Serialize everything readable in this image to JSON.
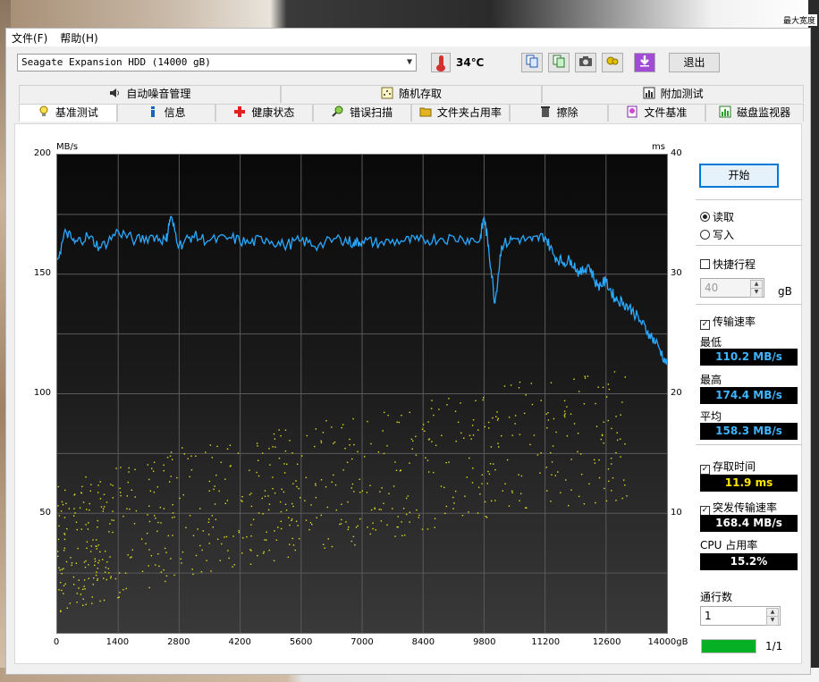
{
  "menu": {
    "file": "文件(F)",
    "help": "帮助(H)"
  },
  "toolbar": {
    "drive": "Seagate Expansion HDD (14000 gB)",
    "temperature": "34℃",
    "exit": "退出",
    "icons": [
      "copy-text-icon",
      "copy-screenshot-icon",
      "camera-icon",
      "settings-icon",
      "save-icon"
    ]
  },
  "tabs_top": [
    "自动噪音管理",
    "随机存取",
    "附加测试"
  ],
  "tabs_bottom": [
    "基准测试",
    "信息",
    "健康状态",
    "错误扫描",
    "文件夹占用率",
    "擦除",
    "文件基准",
    "磁盘监视器"
  ],
  "active_tab": "基准测试",
  "side": {
    "start": "开始",
    "read": "读取",
    "write": "写入",
    "quick": "快捷行程",
    "quick_value": "40",
    "gb": "gB",
    "transfer_rate": "传输速率",
    "min_label": "最低",
    "min_value": "110.2 MB/s",
    "max_label": "最高",
    "max_value": "174.4 MB/s",
    "avg_label": "平均",
    "avg_value": "158.3 MB/s",
    "access_time": "存取时间",
    "access_value": "11.9 ms",
    "burst": "突发传输速率",
    "burst_value": "168.4 MB/s",
    "cpu_label": "CPU 占用率",
    "cpu_value": "15.2%",
    "passes_label": "通行数",
    "passes_value": "1",
    "progress": "1/1",
    "progress_fraction": 1.0
  },
  "chart_data": {
    "type": "line",
    "left_unit": "MB/s",
    "right_unit": "ms",
    "x_unit": "gB",
    "ylim": [
      0,
      200
    ],
    "y2lim": [
      0,
      40
    ],
    "xlim": [
      0,
      14000
    ],
    "yticks": [
      "200",
      "150",
      "100",
      "50"
    ],
    "y2ticks": [
      "40",
      "30",
      "20",
      "10"
    ],
    "xticks": [
      "0",
      "1400",
      "2800",
      "4200",
      "5600",
      "7000",
      "8400",
      "9800",
      "11200",
      "12600",
      "14000gB"
    ],
    "grid": true,
    "series": [
      {
        "kind": "transfer_rate",
        "color": "#29a9ff",
        "x": [
          0,
          200,
          400,
          700,
          1000,
          1400,
          1800,
          2200,
          2500,
          2600,
          2800,
          3100,
          3500,
          4000,
          4400,
          4800,
          5200,
          5600,
          6000,
          6500,
          6800,
          7000,
          7400,
          7900,
          8300,
          8800,
          9300,
          9700,
          9800,
          9900,
          10050,
          10200,
          10500,
          10900,
          11200,
          11400,
          11600,
          11800,
          12000,
          12200,
          12400,
          12600,
          12800,
          13000,
          13200,
          13400,
          13600,
          13800,
          14000
        ],
        "y": [
          156,
          168,
          163,
          166,
          161,
          168,
          164,
          166,
          164,
          174,
          162,
          166,
          164,
          165,
          163,
          165,
          162,
          164,
          162,
          165,
          163,
          164,
          163,
          164,
          164,
          165,
          165,
          164,
          174,
          162,
          138,
          162,
          165,
          164,
          166,
          158,
          155,
          156,
          150,
          154,
          145,
          147,
          140,
          138,
          135,
          130,
          125,
          120,
          112
        ]
      },
      {
        "kind": "access_time",
        "color": "#e0e020",
        "trend": {
          "x": [
            0,
            2800,
            5600,
            8400,
            11200,
            12600,
            14000
          ],
          "y": [
            7,
            10,
            12,
            14,
            16,
            16.5,
            17
          ]
        }
      }
    ]
  }
}
